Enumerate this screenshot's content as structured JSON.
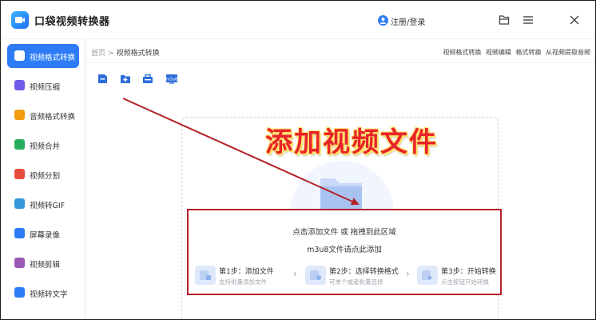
{
  "app": {
    "title": "口袋视频转换器",
    "login": "注册/登录"
  },
  "window": {
    "menu_icon": "file-icon",
    "more_icon": "hamburger-icon",
    "close_icon": "close-icon"
  },
  "sidebar": {
    "items": [
      {
        "label": "视频格式转换",
        "color": "#2d7cf6",
        "active": true
      },
      {
        "label": "视频压缩",
        "color": "#6c5ce7"
      },
      {
        "label": "音频格式转换",
        "color": "#f39c12"
      },
      {
        "label": "视频合并",
        "color": "#27ae60"
      },
      {
        "label": "视频分割",
        "color": "#e74c3c"
      },
      {
        "label": "视频转GIF",
        "color": "#3498db"
      },
      {
        "label": "屏幕录像",
        "color": "#2d7cf6"
      },
      {
        "label": "视频剪辑",
        "color": "#9b59b6"
      },
      {
        "label": "视频转文字",
        "color": "#2d7cf6"
      }
    ]
  },
  "breadcrumb": {
    "home": "首页",
    "sep": ">",
    "current": "视频格式转换"
  },
  "toplinks": {
    "items": [
      "视频格式转换",
      "视频编辑",
      "格式转换",
      "从视频提取音频"
    ]
  },
  "toolbar": [
    "add-file-icon",
    "add-folder-icon",
    "clear-list-icon",
    "m3u8-icon"
  ],
  "annotation": {
    "headline": "添加视频文件"
  },
  "dropzone": {
    "hint1": "点击添加文件 或 拖拽到此区域",
    "hint2": "m3u8文件请点此添加",
    "steps": [
      {
        "title": "第1步：添加文件",
        "desc": "支持批量添加文件"
      },
      {
        "title": "第2步：选择转换格式",
        "desc": "可单个或者批量选择"
      },
      {
        "title": "第3步：开始转换",
        "desc": "点击按钮开始转换"
      }
    ]
  },
  "colors": {
    "accent": "#2d7cf6",
    "annotation_red": "#e8242b",
    "annotation_box": "#b3232a"
  }
}
